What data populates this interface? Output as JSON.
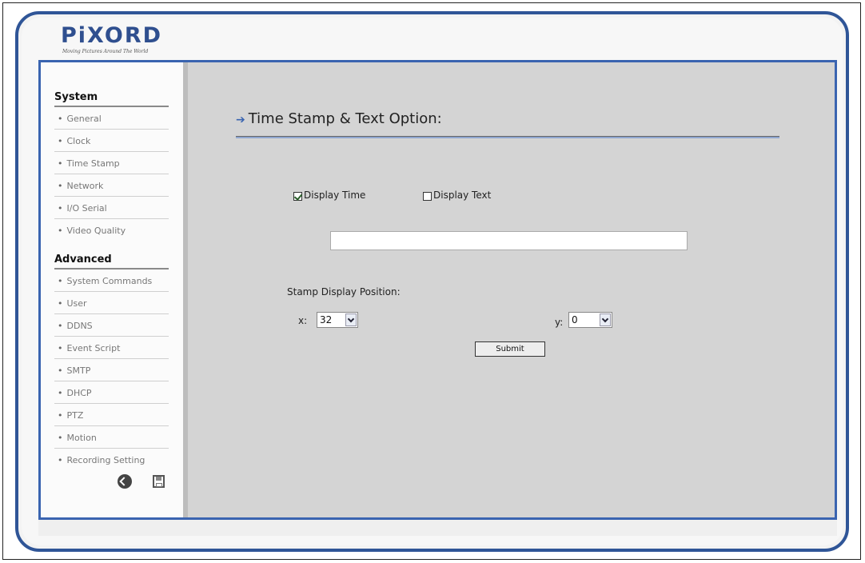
{
  "logo": {
    "name": "PiXORD",
    "tagline": "Moving Pictures Around The World"
  },
  "sidebar": {
    "system_title": "System",
    "system_items": [
      {
        "label": "General"
      },
      {
        "label": "Clock"
      },
      {
        "label": "Time Stamp"
      },
      {
        "label": "Network"
      },
      {
        "label": "I/O Serial"
      },
      {
        "label": "Video Quality"
      }
    ],
    "advanced_title": "Advanced",
    "advanced_items": [
      {
        "label": "System Commands"
      },
      {
        "label": "User"
      },
      {
        "label": "DDNS"
      },
      {
        "label": "Event Script"
      },
      {
        "label": "SMTP"
      },
      {
        "label": "DHCP"
      },
      {
        "label": "PTZ"
      },
      {
        "label": "Motion"
      },
      {
        "label": "Recording Setting"
      }
    ],
    "icons": {
      "back": "back-arrow-icon",
      "save": "floppy-disk-icon"
    }
  },
  "main": {
    "title": "Time Stamp & Text Option:",
    "display_time": {
      "label": "Display Time",
      "checked": true
    },
    "display_text": {
      "label": "Display Text",
      "checked": false
    },
    "text_value": "",
    "position_label": "Stamp Display Position:",
    "x_label": "x:",
    "x_value": "32",
    "y_label": "y:",
    "y_value": "0",
    "submit_label": "Submit"
  },
  "colors": {
    "accent": "#3a64b0",
    "content_bg": "#d4d4d4",
    "logo": "#2f4f8f"
  }
}
